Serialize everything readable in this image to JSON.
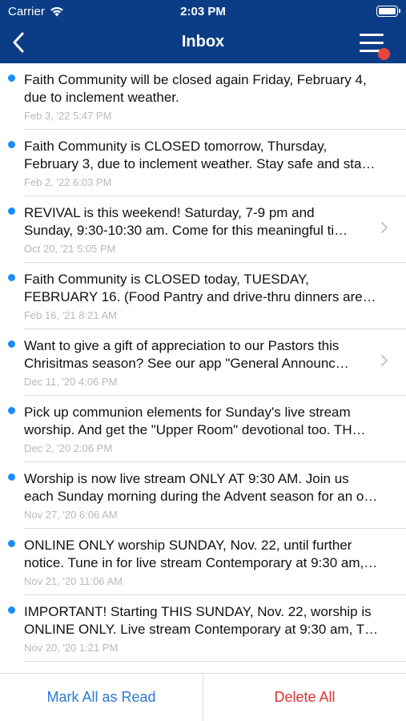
{
  "status_bar": {
    "carrier": "Carrier",
    "time": "2:03 PM"
  },
  "nav": {
    "title": "Inbox"
  },
  "colors": {
    "header": "#0b3d86",
    "unread": "#1a8cff",
    "badge": "#e8453c",
    "link": "#2a7ad8",
    "danger": "#e0312f"
  },
  "messages": [
    {
      "line1": "Faith Community will be closed again Friday, February 4,",
      "line2": "due to inclement weather.",
      "date": "Feb 3, '22 5:47 PM",
      "chevron": false
    },
    {
      "line1": "Faith Community is CLOSED tomorrow, Thursday,",
      "line2": "February 3, due to inclement weather. Stay safe and sta…",
      "date": "Feb 2, '22 6:03 PM",
      "chevron": false
    },
    {
      "line1": "REVIVAL is this weekend! Saturday, 7-9 pm and",
      "line2": "Sunday, 9:30-10:30 am. Come for this meaningful ti…",
      "date": "Oct 20, '21 5:05 PM",
      "chevron": true
    },
    {
      "line1": "Faith Community is CLOSED today, TUESDAY,",
      "line2": "FEBRUARY 16. (Food Pantry and drive-thru dinners are…",
      "date": "Feb 16, '21 8:21 AM",
      "chevron": false
    },
    {
      "line1": "Want to give a gift of appreciation to our Pastors this",
      "line2": "Chrisitmas season? See our app \"General Announc…",
      "date": "Dec 11, '20 4:06 PM",
      "chevron": true
    },
    {
      "line1": "Pick up communion elements for Sunday's live stream",
      "line2": "worship. And get the \"Upper Room\" devotional too. TH…",
      "date": "Dec 2, '20 2:06 PM",
      "chevron": false
    },
    {
      "line1": "Worship is now live stream ONLY AT 9:30 AM. Join us",
      "line2": "each Sunday morning during the Advent season for an o…",
      "date": "Nov 27, '20 6:06 AM",
      "chevron": false
    },
    {
      "line1": "ONLINE ONLY worship SUNDAY, Nov. 22, until further",
      "line2": "notice. Tune in for live stream Contemporary at 9:30 am,…",
      "date": "Nov 21, '20 11:06 AM",
      "chevron": false
    },
    {
      "line1": "IMPORTANT! Starting THIS SUNDAY, Nov. 22, worship is",
      "line2": "ONLINE ONLY. Live stream Contemporary at 9:30 am, T…",
      "date": "Nov 20, '20 1:21 PM",
      "chevron": false
    }
  ],
  "footer": {
    "mark_all_label": "Mark All as Read",
    "delete_all_label": "Delete All"
  }
}
